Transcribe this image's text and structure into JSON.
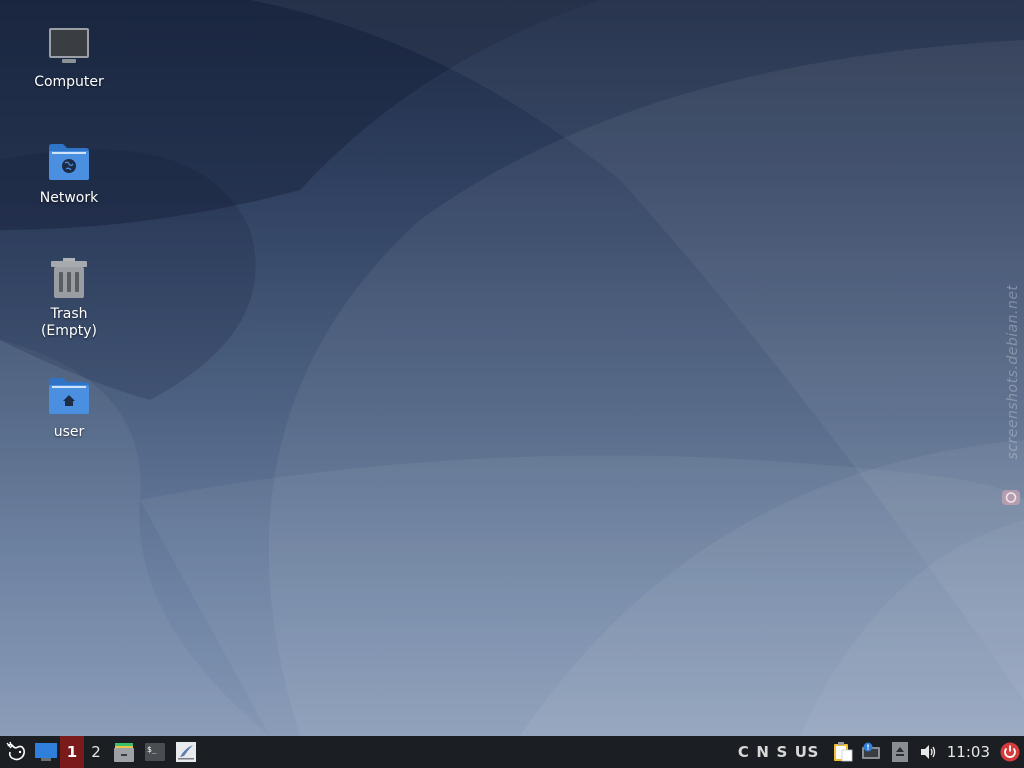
{
  "desktop": {
    "icons": [
      {
        "label": "Computer",
        "icon": "computer-icon"
      },
      {
        "label": "Network",
        "icon": "network-folder-icon"
      },
      {
        "label": "Trash\n(Empty)",
        "icon": "trash-icon"
      },
      {
        "label": "user",
        "icon": "home-folder-icon"
      }
    ],
    "watermark": "screenshots.debian.net"
  },
  "taskbar": {
    "workspaces": [
      {
        "label": "1",
        "active": true
      },
      {
        "label": "2",
        "active": false
      }
    ],
    "launchers": [
      "file-manager-icon",
      "terminal-icon",
      "text-editor-icon"
    ],
    "keyboard_indicators": [
      "C",
      "N",
      "S",
      "US"
    ],
    "tray": [
      "clipboard-icon",
      "network-notify-icon",
      "eject-icon",
      "volume-icon"
    ],
    "clock": "11:03"
  },
  "colors": {
    "taskbar_bg": "#1b1e22",
    "active_workspace": "#7a1a1a",
    "folder_blue": "#3d86d8",
    "power_red": "#d43b3b"
  }
}
